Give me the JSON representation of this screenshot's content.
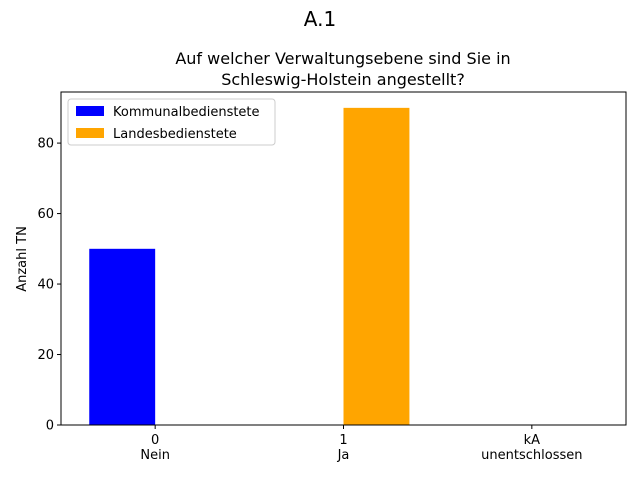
{
  "figure": {
    "suptitle": "A.1"
  },
  "chart_data": {
    "type": "bar",
    "title_lines": [
      "Auf welcher Verwaltungsebene sind Sie in",
      "Schleswig-Holstein angestellt?"
    ],
    "ylabel": "Anzahl TN",
    "xlabel": "",
    "categories": [
      [
        "0",
        "Nein"
      ],
      [
        "1",
        "Ja"
      ],
      [
        "kA",
        "unentschlossen"
      ]
    ],
    "series": [
      {
        "name": "Kommunalbedienstete",
        "color": "#0000ff",
        "values": [
          50,
          0,
          0
        ]
      },
      {
        "name": "Landesbedienstete",
        "color": "#ffa500",
        "values": [
          0,
          90,
          0
        ]
      }
    ],
    "ylim": [
      0,
      94.5
    ],
    "yticks": [
      0,
      20,
      40,
      60,
      80
    ],
    "grid": false,
    "legend_position": "upper-left"
  }
}
